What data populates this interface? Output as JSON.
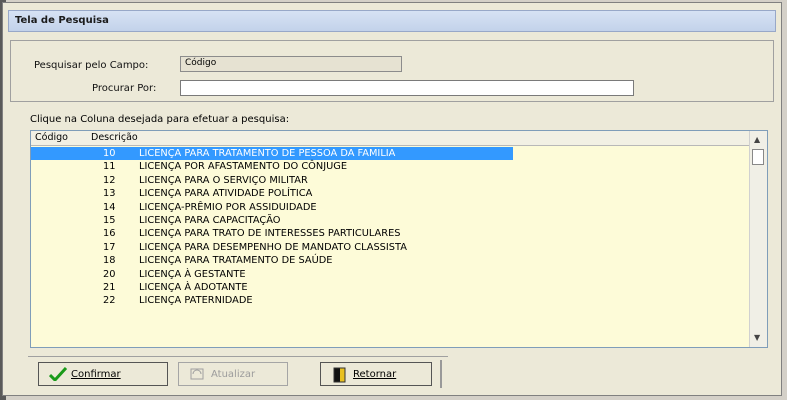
{
  "window": {
    "title": "Tela de Pesquisa"
  },
  "search": {
    "field_label": "Pesquisar pelo Campo:",
    "field_value": "Código",
    "query_label": "Procurar Por:",
    "query_value": ""
  },
  "grid": {
    "hint": "Clique na Coluna desejada para efetuar a pesquisa:",
    "columns": [
      "Código",
      "Descrição"
    ],
    "rows": [
      {
        "code": "10",
        "desc": "LICENÇA PARA TRATAMENTO DE PESSOA DA FAMILIA"
      },
      {
        "code": "11",
        "desc": "LICENÇA POR AFASTAMENTO DO CÔNJUGE"
      },
      {
        "code": "12",
        "desc": "LICENÇA PARA O SERVIÇO MILITAR"
      },
      {
        "code": "13",
        "desc": "LICENÇA PARA ATIVIDADE POLÍTICA"
      },
      {
        "code": "14",
        "desc": "LICENÇA-PRÊMIO POR ASSIDUIDADE"
      },
      {
        "code": "15",
        "desc": "LICENÇA PARA CAPACITAÇÃO"
      },
      {
        "code": "16",
        "desc": "LICENÇA PARA TRATO DE INTERESSES PARTICULARES"
      },
      {
        "code": "17",
        "desc": "LICENÇA PARA  DESEMPENHO DE MANDATO CLASSISTA"
      },
      {
        "code": "18",
        "desc": "LICENÇA PARA TRATAMENTO DE SAÚDE"
      },
      {
        "code": "20",
        "desc": "LICENÇA À GESTANTE"
      },
      {
        "code": "21",
        "desc": "LICENÇA À ADOTANTE"
      },
      {
        "code": "22",
        "desc": "LICENÇA PATERNIDADE"
      }
    ],
    "selected_index": 0
  },
  "buttons": {
    "confirm": "Confirmar",
    "refresh": "Atualizar",
    "back": "Retornar"
  },
  "colors": {
    "selection": "#3399ff",
    "grid_bg": "#fdfbd8",
    "confirm_icon": "#1a9a1a"
  }
}
